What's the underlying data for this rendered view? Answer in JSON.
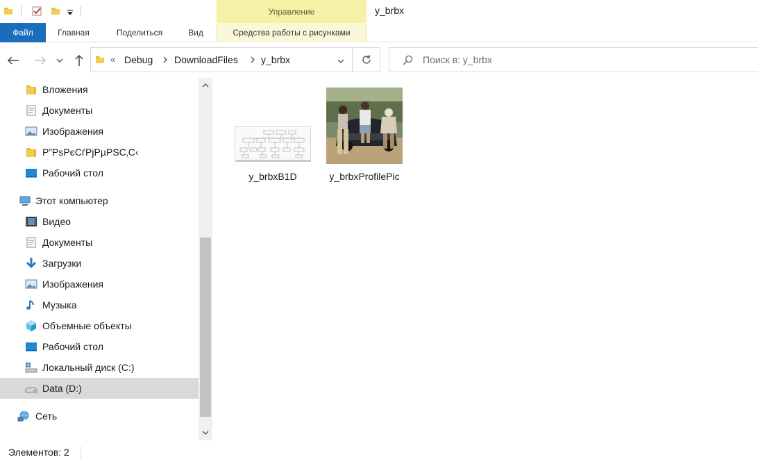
{
  "window": {
    "title": "y_brbx",
    "contextual_tab_group": "Управление"
  },
  "ribbon": {
    "tabs": [
      {
        "label": "Файл"
      },
      {
        "label": "Главная"
      },
      {
        "label": "Поделиться"
      },
      {
        "label": "Вид"
      },
      {
        "label": "Средства работы с рисунками"
      }
    ]
  },
  "address": {
    "overflow": "«",
    "crumbs": [
      "Debug",
      "DownloadFiles",
      "y_brbx"
    ]
  },
  "search": {
    "placeholder": "Поиск в: y_brbx",
    "value": ""
  },
  "sidebar": {
    "items": [
      {
        "label": "Вложения",
        "icon": "folder-icon"
      },
      {
        "label": "Документы",
        "icon": "documents-icon"
      },
      {
        "label": "Изображения",
        "icon": "pictures-icon"
      },
      {
        "label": "Р”РѕРєСѓРјРµРЅС‚С‹",
        "icon": "folder-icon"
      },
      {
        "label": "Рабочий стол",
        "icon": "desktop-icon"
      },
      {
        "label": "Этот компьютер",
        "icon": "computer-icon"
      },
      {
        "label": "Видео",
        "icon": "video-icon"
      },
      {
        "label": "Документы",
        "icon": "documents-icon"
      },
      {
        "label": "Загрузки",
        "icon": "download-icon"
      },
      {
        "label": "Изображения",
        "icon": "pictures-icon"
      },
      {
        "label": "Музыка",
        "icon": "music-icon"
      },
      {
        "label": "Объемные объекты",
        "icon": "3d-objects-icon"
      },
      {
        "label": "Рабочий стол",
        "icon": "desktop-icon"
      },
      {
        "label": "Локальный диск (C:)",
        "icon": "system-drive-icon"
      },
      {
        "label": "Data (D:)",
        "icon": "drive-icon"
      },
      {
        "label": "Сеть",
        "icon": "network-icon"
      }
    ]
  },
  "files": [
    {
      "name": "y_brbxB1D",
      "thumbnail": "diagram-thumbnail"
    },
    {
      "name": "y_brbxProfilePic",
      "thumbnail": "photo-thumbnail"
    }
  ],
  "status": {
    "item_count": "Элементов: 2"
  },
  "colors": {
    "file_tab": "#1a6dbd",
    "contextual_tab": "#f6f1a6",
    "selected_item": "#d9d9d9"
  }
}
